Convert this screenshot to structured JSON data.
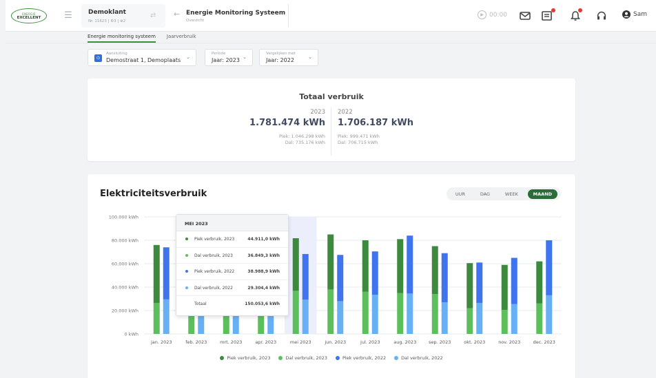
{
  "header": {
    "logo_top": "ENERGIE",
    "logo_bottom": "EXCELLENT",
    "client_name": "Demoklant",
    "client_sub": "Nr. 11623 | ⚙3 | ⊕2",
    "page_title": "Energie Monitoring Systeem",
    "page_sub": "Overzicht",
    "timer": "00:00",
    "user": "Sam"
  },
  "tabs": [
    {
      "label": "Energie monitoring systeem",
      "active": true
    },
    {
      "label": "Jaarverbruik",
      "active": false
    }
  ],
  "filters": {
    "aansluiting": {
      "label": "Aansluiting",
      "value": "Demostraat 1, Demoplaats"
    },
    "periode": {
      "label": "Periode",
      "value": "Jaar: 2023"
    },
    "vergelijken": {
      "label": "Vergelijken met",
      "value": "Jaar: 2022"
    }
  },
  "totals": {
    "title": "Totaal verbruik",
    "current": {
      "year": "2023",
      "value": "1.781.474 kWh",
      "piek": "Piek: 1.046.298 kWh",
      "dal": "Dal: 735.176 kWh"
    },
    "compare": {
      "year": "2022",
      "value": "1.706.187 kWh",
      "piek": "Piek: 999.471 kWh",
      "dal": "Dal: 706.715 kWh"
    }
  },
  "chart_card": {
    "title": "Elektriciteitsverbruik",
    "segments": [
      {
        "label": "UUR",
        "active": false
      },
      {
        "label": "DAG",
        "active": false
      },
      {
        "label": "WEEK",
        "active": false
      },
      {
        "label": "MAAND",
        "active": true
      }
    ]
  },
  "tooltip": {
    "title": "MEI 2023",
    "rows": [
      {
        "name": "Piek verbruik, 2023",
        "value": "44.911,0 kWh",
        "color": "#3d8a3e"
      },
      {
        "name": "Dal verbruik, 2023",
        "value": "36.849,3 kWh",
        "color": "#5cbf5c"
      },
      {
        "name": "Piek verbruik, 2022",
        "value": "38.988,9 kWh",
        "color": "#3f74ee"
      },
      {
        "name": "Dal verbruik, 2022",
        "value": "29.304,4 kWh",
        "color": "#68b0f4"
      },
      {
        "name": "Totaal",
        "value": "150.053,6 kWh",
        "color": ""
      }
    ]
  },
  "chart_data": {
    "type": "bar",
    "stacked": true,
    "categories": [
      "jan. 2023",
      "feb. 2023",
      "mrt. 2023",
      "apr. 2023",
      "mei 2023",
      "jun. 2023",
      "jul. 2023",
      "aug. 2023",
      "sep. 2023",
      "okt. 2023",
      "nov. 2023",
      "dec. 2023"
    ],
    "ylim": [
      0,
      100000
    ],
    "yticks": [
      "0 kWh",
      "20.000 kWh",
      "40.000 kWh",
      "60.000 kWh",
      "80.000 kWh",
      "100.000 kWh"
    ],
    "highlight_category": "mei 2023",
    "groups": [
      {
        "stack": "2023",
        "series": [
          {
            "name": "Dal verbruik, 2023",
            "color": "#5cbf5c",
            "values": [
              26500,
              23000,
              28000,
              31000,
              36849,
              38000,
              36000,
              35000,
              34000,
              22000,
              20500,
              26000
            ]
          },
          {
            "name": "Piek verbruik, 2023",
            "color": "#3d8a3e",
            "values": [
              49500,
              45000,
              40000,
              44000,
              44911,
              47000,
              44000,
              46000,
              41000,
              38500,
              38500,
              36000
            ]
          }
        ]
      },
      {
        "stack": "2022",
        "series": [
          {
            "name": "Dal verbruik, 2022",
            "color": "#68b0f4",
            "values": [
              29500,
              25000,
              24000,
              27000,
              29304,
              28000,
              33500,
              34500,
              27000,
              26500,
              25500,
              33000
            ]
          },
          {
            "name": "Piek verbruik, 2022",
            "color": "#3f74ee",
            "values": [
              44500,
              40000,
              36000,
              41000,
              38989,
              39500,
              37000,
              49500,
              42000,
              34500,
              39500,
              47000
            ]
          }
        ]
      }
    ],
    "legend": [
      "Piek verbruik, 2023",
      "Dal verbruik, 2023",
      "Piek verbruik, 2022",
      "Dal verbruik, 2022"
    ]
  },
  "colors": {
    "piek_2023": "#3d8a3e",
    "dal_2023": "#5cbf5c",
    "piek_2022": "#3f74ee",
    "dal_2022": "#68b0f4",
    "accent": "#2e6b3a"
  }
}
